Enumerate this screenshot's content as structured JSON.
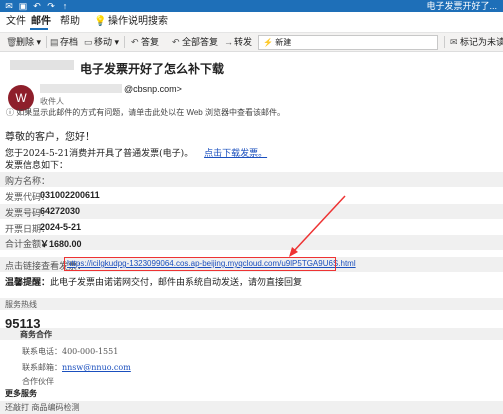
{
  "window": {
    "title": "电子发票开好了..."
  },
  "menu": {
    "file": "文件",
    "mail": "邮件",
    "help": "帮助",
    "search": "操作说明搜索"
  },
  "toolbar": {
    "delete": "删除",
    "archive": "存档",
    "move": "移动",
    "reply": "答复",
    "reply_all": "全部答复",
    "forward": "转发",
    "new_field": "新建",
    "mark_unread": "标记为未读"
  },
  "message": {
    "subject": "电子发票开好了怎么补下载",
    "sender": "@cbsnp.com>",
    "avatar_letter": "W",
    "recipient_label": "收件人",
    "info": "如果显示此邮件的方式有问题，请单击此处以在 Web 浏览器中查看该邮件。"
  },
  "content": {
    "greeting": "尊敬的客户，您好！",
    "line1": "您于2024-5-21消费并开具了普通发票(电子)。",
    "download_link": "点击下载发票。",
    "line2": "发票信息如下：",
    "buyer_label": "购方名称：",
    "code_label": "发票代码：",
    "code_value": "031002200611",
    "number_label": "发票号码：",
    "number_value": "64272030",
    "date_label": "开票日期：",
    "date_value": "2024-5-21",
    "amount_label": "合计金额：",
    "amount_value": "￥1680.00",
    "link_label": "点击链接查看发票：",
    "link_url": "https://icilgkudpg-1323099064.cos.ap-beijing.myqcloud.com/u9lP5TGA9U6S.html",
    "reminder_label": "温馨提醒：",
    "reminder_text": "此电子发票由诺诺网交付，邮件由系统自动发送，请勿直接回复",
    "hotline_label": "服务热线",
    "hotline_value": "95113",
    "biz_label": "商务合作",
    "phone_line": "联系电话：400-000-1551",
    "email_label": "联系邮箱：",
    "email_value": "nnsw@nnuo.com",
    "coop_label": "合作伙伴",
    "more_label": "更多服务",
    "footer": "还敲打 商品编码检测"
  }
}
